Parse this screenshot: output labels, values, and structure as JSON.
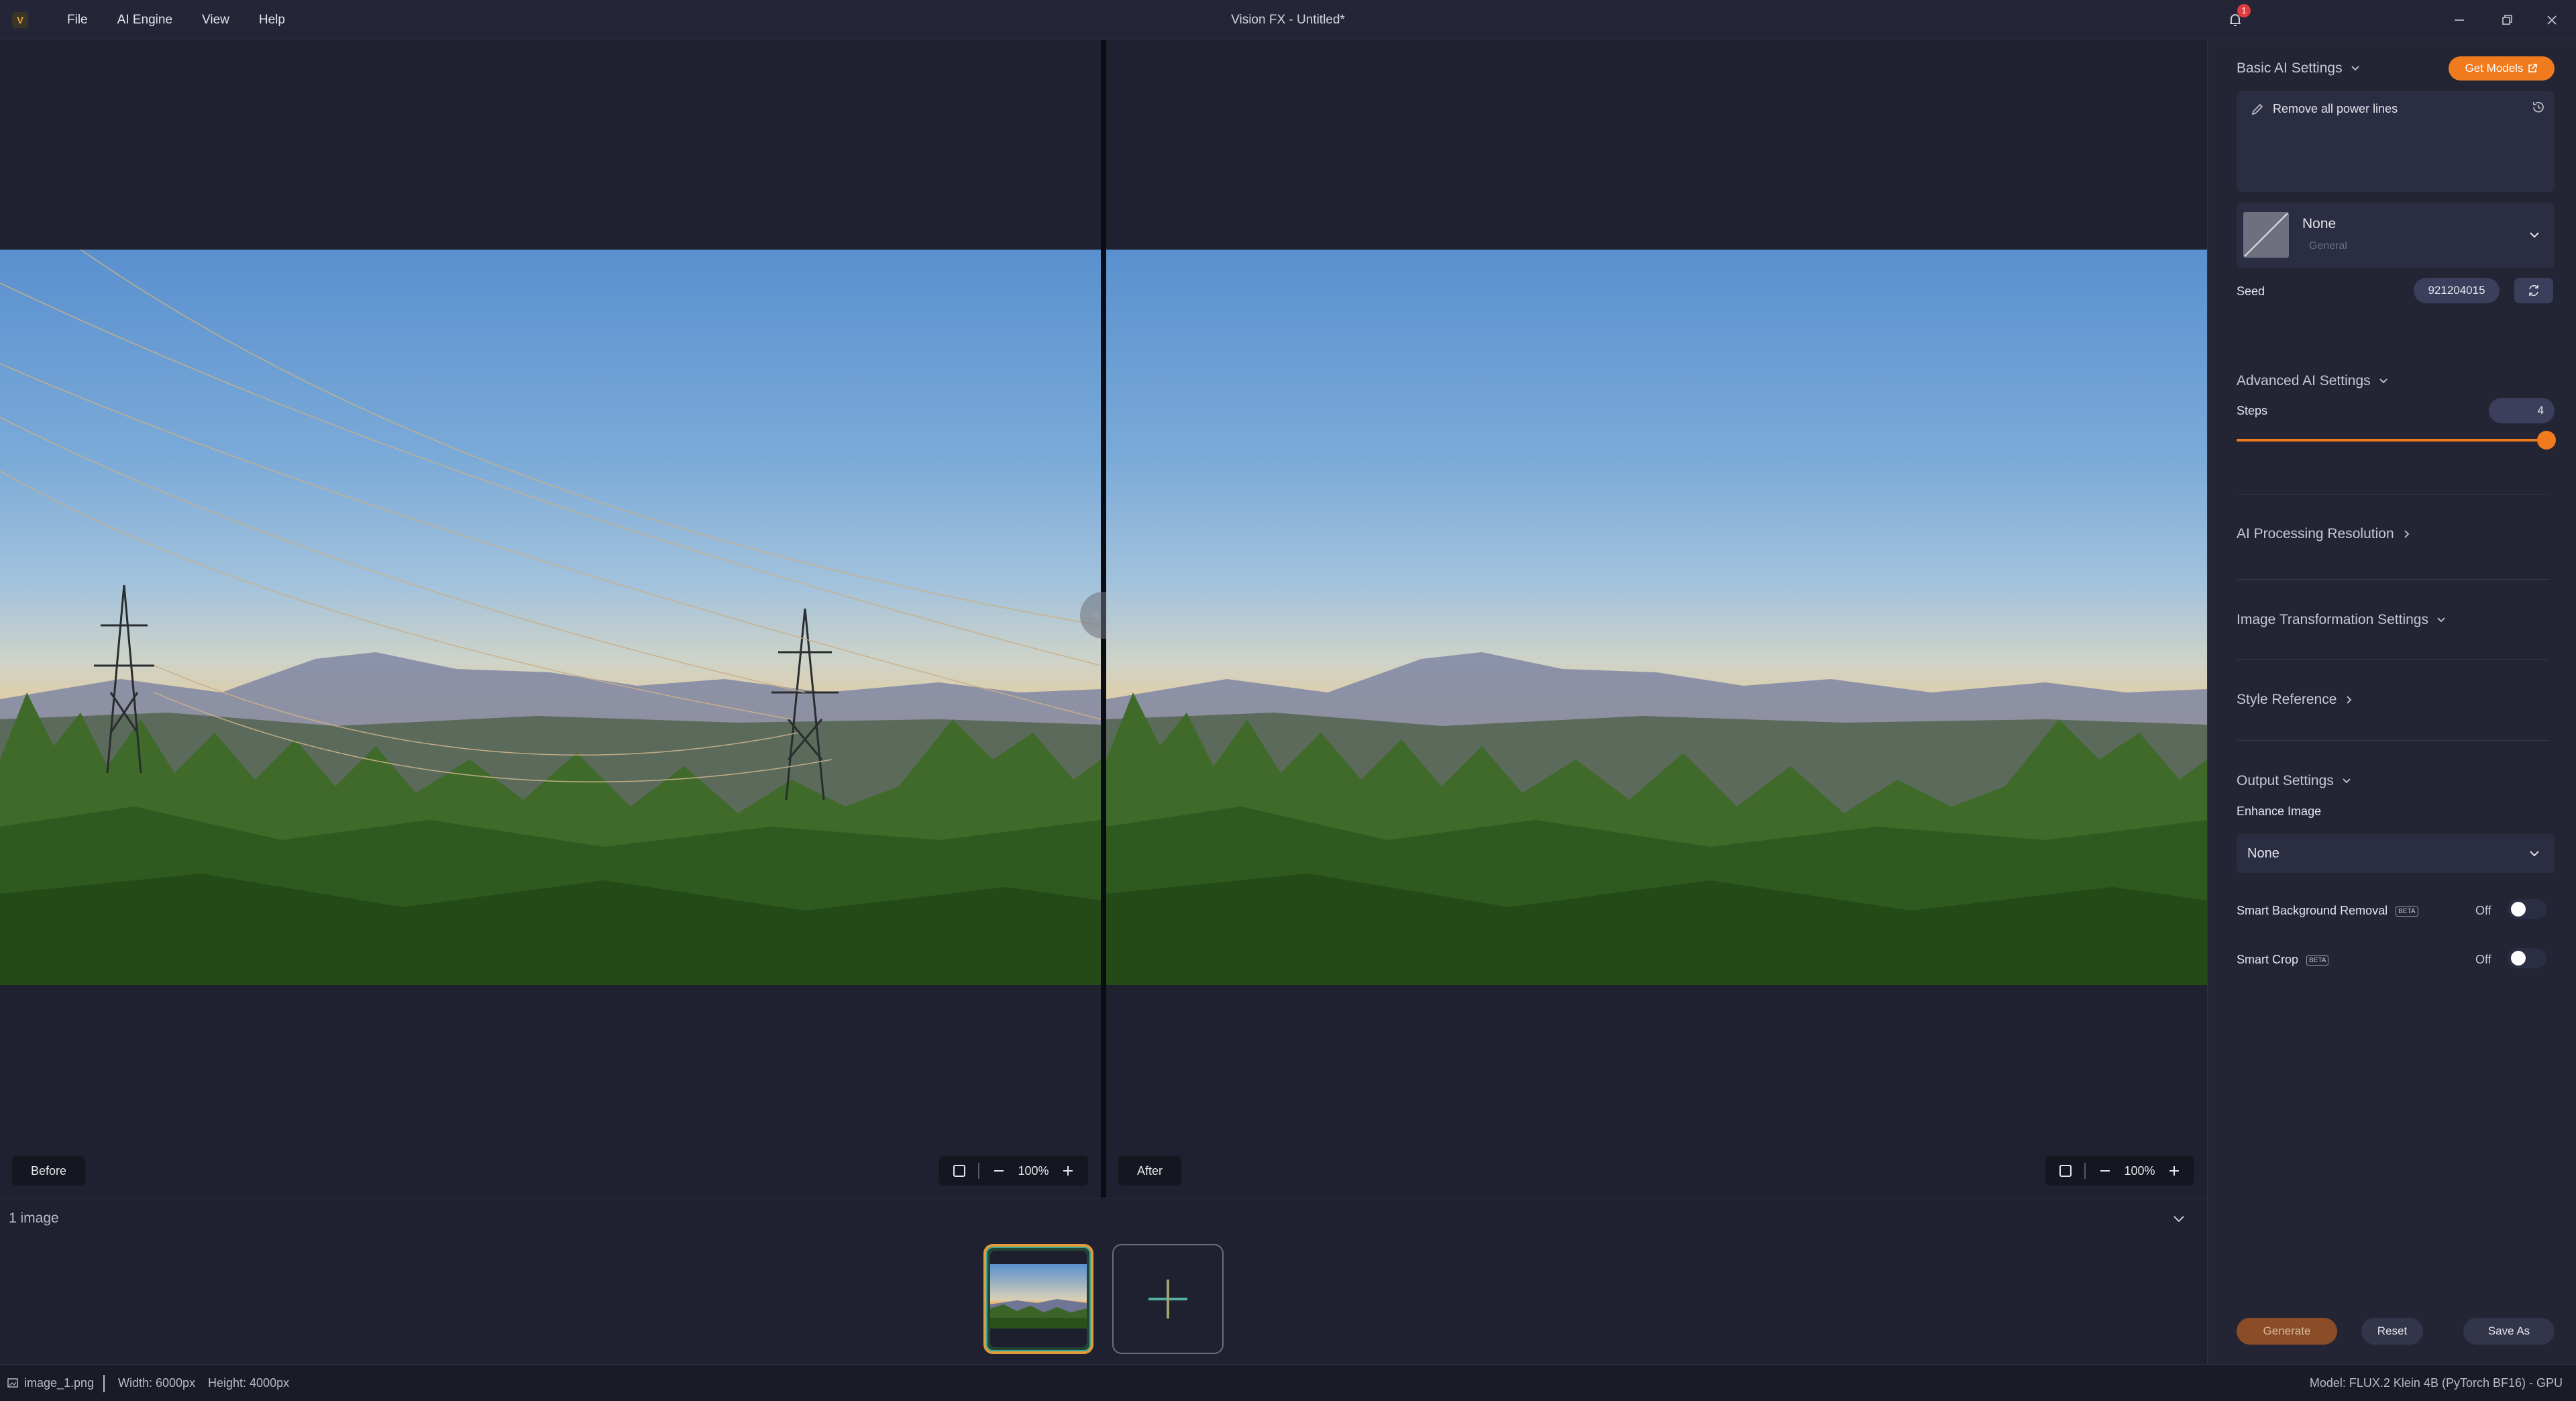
{
  "titlebar": {
    "app_logo": "V",
    "menu": [
      "File",
      "AI Engine",
      "View",
      "Help"
    ],
    "window_title": "Vision FX - Untitled*",
    "notification_count": "1"
  },
  "canvas": {
    "before_label": "Before",
    "after_label": "After",
    "before_zoom": "100%",
    "after_zoom": "100%"
  },
  "filmstrip": {
    "count_label": "1 image"
  },
  "statusbar": {
    "filename": "image_1.png",
    "width": "Width: 6000px",
    "height": "Height: 4000px",
    "model": "Model: FLUX.2 Klein 4B (PyTorch BF16) - GPU"
  },
  "panel": {
    "basic": {
      "title": "Basic AI Settings",
      "get_models": "Get Models",
      "prompt": "Remove all power lines",
      "model_name": "None",
      "model_category": "General",
      "seed_label": "Seed",
      "seed_value": "921204015"
    },
    "advanced": {
      "title": "Advanced AI Settings",
      "steps_label": "Steps",
      "steps_value": "4",
      "steps_fraction": 1.0
    },
    "resolution_title": "AI Processing Resolution",
    "transformation_title": "Image Transformation Settings",
    "style_title": "Style Reference",
    "output": {
      "title": "Output Settings",
      "enhance_label": "Enhance Image",
      "enhance_value": "None",
      "bg_removal_label": "Smart Background Removal",
      "bg_removal_badge": "BETA",
      "bg_removal_state": "Off",
      "smart_crop_label": "Smart Crop",
      "smart_crop_badge": "BETA",
      "smart_crop_state": "Off"
    },
    "buttons": {
      "generate": "Generate",
      "reset": "Reset",
      "save_as": "Save As"
    }
  },
  "colors": {
    "accent": "#f07a1e",
    "background": "#1f2130",
    "panel": "#232535"
  }
}
